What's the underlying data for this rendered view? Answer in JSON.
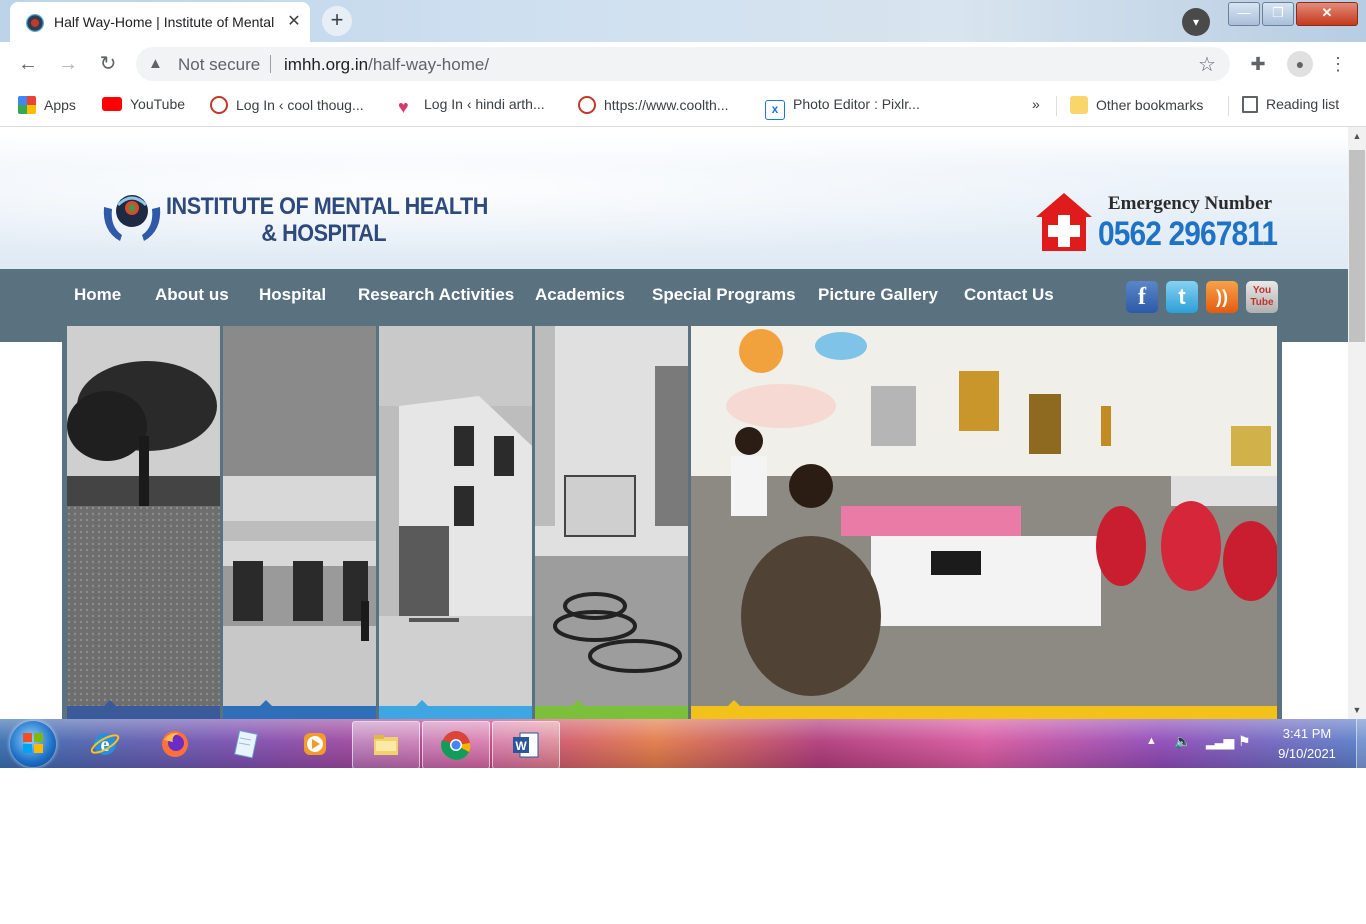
{
  "browser": {
    "tab_title": "Half Way-Home | Institute of Mental Health & Hospital",
    "new_tab_symbol": "+",
    "close_symbol": "✕",
    "security_label": "Not secure",
    "url_host": "imhh.org.in",
    "url_path": "/half-way-home/"
  },
  "bookmarks": {
    "items": [
      {
        "label": "Apps",
        "icon": "apps-grid-icon"
      },
      {
        "label": "YouTube",
        "icon": "youtube-icon"
      },
      {
        "label": "Log In ‹ cool thoug...",
        "icon": "wordpress-icon"
      },
      {
        "label": "Log In ‹ hindi arth...",
        "icon": "heart-icon"
      },
      {
        "label": "https://www.coolth...",
        "icon": "wordpress-icon"
      },
      {
        "label": "Photo Editor : Pixlr...",
        "icon": "pixlr-icon"
      }
    ],
    "overflow": "»",
    "other": "Other bookmarks",
    "reading_list": "Reading list"
  },
  "site": {
    "logo_line1": "INSTITUTE OF MENTAL HEALTH",
    "logo_line2": "& HOSPITAL",
    "emergency_label": "Emergency Number",
    "emergency_number": "0562 2967811",
    "nav": [
      "Home",
      "About us",
      "Hospital",
      "Research Activities",
      "Academics",
      "Special Programs",
      "Picture Gallery",
      "Contact Us"
    ],
    "social": {
      "facebook": "f",
      "twitter": "t",
      "rss": "))",
      "youtube_line1": "You",
      "youtube_line2": "Tube"
    },
    "slider_bar_colors": [
      "#3b5a9a",
      "#2f6fb8",
      "#3ea6e0",
      "#7bbf3a",
      "#f2c21b"
    ]
  },
  "taskbar": {
    "time": "3:41 PM",
    "date": "9/10/2021",
    "apps": [
      "internet-explorer",
      "firefox",
      "notepad",
      "media-player",
      "file-explorer",
      "chrome",
      "word"
    ]
  }
}
